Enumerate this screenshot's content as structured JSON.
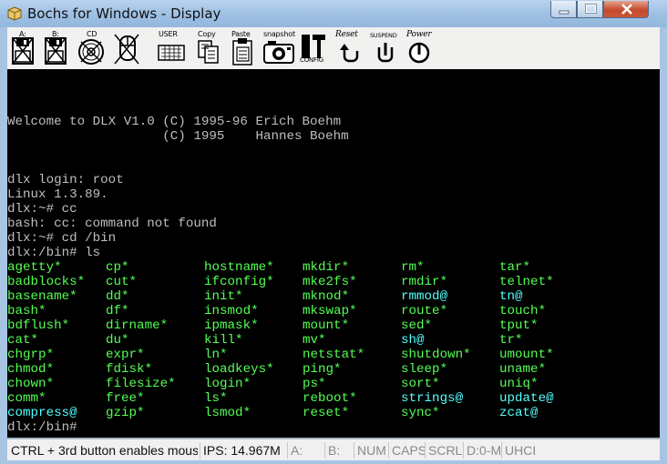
{
  "window": {
    "title": "Bochs for Windows - Display"
  },
  "toolbar": {
    "items": [
      {
        "id": "floppy-a",
        "label": "A:",
        "icon": "floppy-disk-icon"
      },
      {
        "id": "floppy-b",
        "label": "B:",
        "icon": "floppy-disk-icon"
      },
      {
        "id": "cdrom",
        "label": "CD",
        "icon": "cdrom-icon"
      },
      {
        "id": "mouse",
        "label": "",
        "icon": "mouse-disabled-icon"
      },
      {
        "id": "user",
        "label": "USER",
        "icon": "keyboard-icon"
      },
      {
        "id": "copy",
        "label": "Copy",
        "icon": "copy-icon"
      },
      {
        "id": "paste",
        "label": "Paste",
        "icon": "paste-icon"
      },
      {
        "id": "snapshot",
        "label": "snapshot",
        "icon": "camera-icon"
      },
      {
        "id": "config",
        "label": "CONFIG",
        "icon": "config-icon"
      },
      {
        "id": "reset",
        "label": "Reset",
        "icon": "reset-icon"
      },
      {
        "id": "suspend",
        "label": "SUSPEND",
        "icon": "suspend-icon"
      },
      {
        "id": "power",
        "label": "Power",
        "icon": "power-icon"
      }
    ]
  },
  "terminal": {
    "lines": [
      "",
      "",
      "",
      "Welcome to DLX V1.0 (C) 1995-96 Erich Boehm",
      "                    (C) 1995    Hannes Boehm",
      "",
      "",
      "dlx login: root",
      "Linux 1.3.89.",
      "dlx:~# cc",
      "bash: cc: command not found",
      "dlx:~# cd /bin",
      "dlx:/bin# ls"
    ],
    "listing": [
      [
        {
          "t": "agetty*",
          "k": "exec"
        },
        {
          "t": "cp*",
          "k": "exec"
        },
        {
          "t": "hostname*",
          "k": "exec"
        },
        {
          "t": "mkdir*",
          "k": "exec"
        },
        {
          "t": "rm*",
          "k": "exec"
        },
        {
          "t": "tar*",
          "k": "exec"
        }
      ],
      [
        {
          "t": "badblocks*",
          "k": "exec"
        },
        {
          "t": "cut*",
          "k": "exec"
        },
        {
          "t": "ifconfig*",
          "k": "exec"
        },
        {
          "t": "mke2fs*",
          "k": "exec"
        },
        {
          "t": "rmdir*",
          "k": "exec"
        },
        {
          "t": "telnet*",
          "k": "exec"
        }
      ],
      [
        {
          "t": "basename*",
          "k": "exec"
        },
        {
          "t": "dd*",
          "k": "exec"
        },
        {
          "t": "init*",
          "k": "exec"
        },
        {
          "t": "mknod*",
          "k": "exec"
        },
        {
          "t": "rmmod@",
          "k": "link"
        },
        {
          "t": "tn@",
          "k": "link"
        }
      ],
      [
        {
          "t": "bash*",
          "k": "exec"
        },
        {
          "t": "df*",
          "k": "exec"
        },
        {
          "t": "insmod*",
          "k": "exec"
        },
        {
          "t": "mkswap*",
          "k": "exec"
        },
        {
          "t": "route*",
          "k": "exec"
        },
        {
          "t": "touch*",
          "k": "exec"
        }
      ],
      [
        {
          "t": "bdflush*",
          "k": "exec"
        },
        {
          "t": "dirname*",
          "k": "exec"
        },
        {
          "t": "ipmask*",
          "k": "exec"
        },
        {
          "t": "mount*",
          "k": "exec"
        },
        {
          "t": "sed*",
          "k": "exec"
        },
        {
          "t": "tput*",
          "k": "exec"
        }
      ],
      [
        {
          "t": "cat*",
          "k": "exec"
        },
        {
          "t": "du*",
          "k": "exec"
        },
        {
          "t": "kill*",
          "k": "exec"
        },
        {
          "t": "mv*",
          "k": "exec"
        },
        {
          "t": "sh@",
          "k": "link"
        },
        {
          "t": "tr*",
          "k": "exec"
        }
      ],
      [
        {
          "t": "chgrp*",
          "k": "exec"
        },
        {
          "t": "expr*",
          "k": "exec"
        },
        {
          "t": "ln*",
          "k": "exec"
        },
        {
          "t": "netstat*",
          "k": "exec"
        },
        {
          "t": "shutdown*",
          "k": "exec"
        },
        {
          "t": "umount*",
          "k": "exec"
        }
      ],
      [
        {
          "t": "chmod*",
          "k": "exec"
        },
        {
          "t": "fdisk*",
          "k": "exec"
        },
        {
          "t": "loadkeys*",
          "k": "exec"
        },
        {
          "t": "ping*",
          "k": "exec"
        },
        {
          "t": "sleep*",
          "k": "exec"
        },
        {
          "t": "uname*",
          "k": "exec"
        }
      ],
      [
        {
          "t": "chown*",
          "k": "exec"
        },
        {
          "t": "filesize*",
          "k": "exec"
        },
        {
          "t": "login*",
          "k": "exec"
        },
        {
          "t": "ps*",
          "k": "exec"
        },
        {
          "t": "sort*",
          "k": "exec"
        },
        {
          "t": "uniq*",
          "k": "exec"
        }
      ],
      [
        {
          "t": "comm*",
          "k": "exec"
        },
        {
          "t": "free*",
          "k": "exec"
        },
        {
          "t": "ls*",
          "k": "exec"
        },
        {
          "t": "reboot*",
          "k": "exec"
        },
        {
          "t": "strings@",
          "k": "link"
        },
        {
          "t": "update@",
          "k": "link"
        }
      ],
      [
        {
          "t": "compress@",
          "k": "link"
        },
        {
          "t": "gzip*",
          "k": "exec"
        },
        {
          "t": "lsmod*",
          "k": "exec"
        },
        {
          "t": "reset*",
          "k": "exec"
        },
        {
          "t": "sync*",
          "k": "exec"
        },
        {
          "t": "zcat@",
          "k": "link"
        }
      ]
    ],
    "prompt_after": "dlx:/bin#"
  },
  "statusbar": {
    "hint": "CTRL + 3rd button enables mouse",
    "ips": "IPS: 14.967M",
    "floppy_a": "A:",
    "floppy_b": "B:",
    "num": "NUM",
    "caps": "CAPS",
    "scrl": "SCRL",
    "disk": "D:0-M",
    "uhci": "UHCI"
  },
  "colors": {
    "terminal_bg": "#000000",
    "text": "#bfbfbf",
    "executable": "#54ff54",
    "symlink": "#54ffff"
  }
}
